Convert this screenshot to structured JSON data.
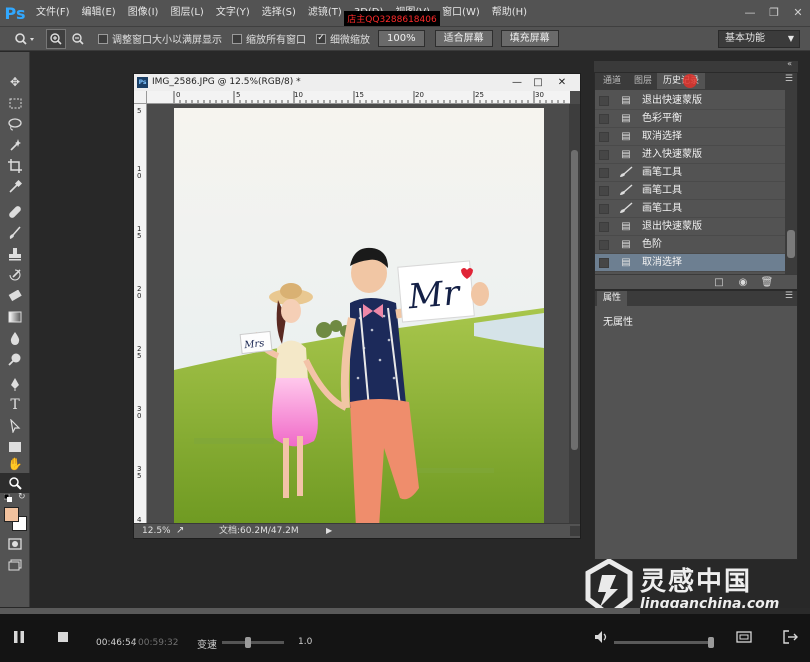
{
  "app": {
    "logo": "Ps",
    "menu": [
      "文件(F)",
      "编辑(E)",
      "图像(I)",
      "图层(L)",
      "文字(Y)",
      "选择(S)",
      "滤镜(T)",
      "3D(D)",
      "视图(V)",
      "窗口(W)",
      "帮助(H)"
    ],
    "overlay_banner": "店主QQ3288618406",
    "window_controls": [
      "minimize",
      "restore",
      "close"
    ]
  },
  "options_bar": {
    "zoom_in_icon": "zoom-in-icon",
    "zoom_out_icon": "zoom-out-icon",
    "resize_windows_label": "调整窗口大小以满屏显示",
    "zoom_all_label": "缩放所有窗口",
    "scrubby_zoom_label": "细微缩放",
    "scrubby_zoom_checked": true,
    "btn_100": "100%",
    "btn_fit": "适合屏幕",
    "btn_fill": "填充屏幕",
    "workspace": "基本功能"
  },
  "document": {
    "title": "IMG_2586.JPG @ 12.5%(RGB/8) *",
    "ruler_top": [
      "0",
      "5",
      "10",
      "15",
      "20",
      "25",
      "30"
    ],
    "ruler_left": [
      "5",
      "1 0",
      "1 5",
      "2 0",
      "2 5",
      "3 0",
      "3 5",
      "4"
    ],
    "zoom": "12.5%",
    "doc_info": "文档:60.2M/47.2M",
    "photo_signs": [
      "Mr",
      "Mrs"
    ]
  },
  "history_panel": {
    "tabs": [
      "通道",
      "图层",
      "历史记录"
    ],
    "active_tab": "历史记录",
    "items": [
      {
        "icon": "doc-icon",
        "label": "退出快速蒙版",
        "selected": false
      },
      {
        "icon": "doc-icon",
        "label": "色彩平衡",
        "selected": false
      },
      {
        "icon": "doc-icon",
        "label": "取消选择",
        "selected": false
      },
      {
        "icon": "doc-icon",
        "label": "进入快速蒙版",
        "selected": false
      },
      {
        "icon": "brush-icon",
        "label": "画笔工具",
        "selected": false
      },
      {
        "icon": "brush-icon",
        "label": "画笔工具",
        "selected": false
      },
      {
        "icon": "brush-icon",
        "label": "画笔工具",
        "selected": false
      },
      {
        "icon": "doc-icon",
        "label": "退出快速蒙版",
        "selected": false
      },
      {
        "icon": "doc-icon",
        "label": "色阶",
        "selected": false
      },
      {
        "icon": "doc-icon",
        "label": "取消选择",
        "selected": true
      }
    ]
  },
  "properties_panel": {
    "tab": "属性",
    "body": "无属性"
  },
  "watermark": {
    "title": "灵感中国",
    "url": "lingganchina.com"
  },
  "player": {
    "current_time": "00:46:54",
    "separator": "/",
    "total_time": "00:59:32",
    "speed_label": "变速",
    "speed_value": "1.0",
    "progress": 0.79,
    "volume": 0.95
  }
}
